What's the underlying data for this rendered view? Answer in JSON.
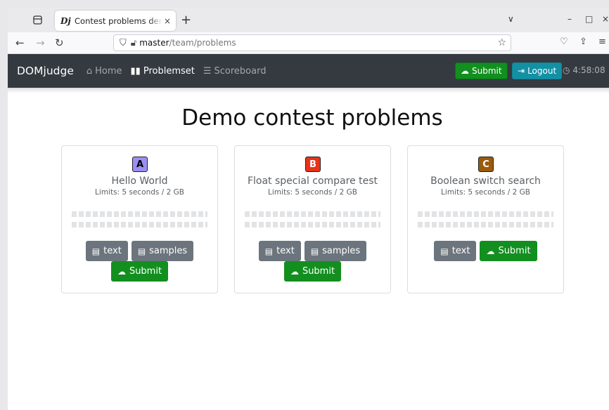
{
  "browser": {
    "tab_title": "Contest problems demo",
    "tab_favicon": "Dj",
    "tab_close": "×",
    "new_tab": "+",
    "url_host": "master",
    "url_path": "/team/problems",
    "window_controls": [
      "∨",
      "–",
      "□",
      "×"
    ]
  },
  "navbar": {
    "brand": "DOMjudge",
    "links": [
      {
        "label": "Home",
        "icon": "home-icon"
      },
      {
        "label": "Problemset",
        "icon": "book-icon"
      },
      {
        "label": "Scoreboard",
        "icon": "list-icon"
      }
    ],
    "submit_label": "Submit",
    "logout_label": "Logout",
    "clock": "4:58:08"
  },
  "page": {
    "title": "Demo contest problems"
  },
  "problems": [
    {
      "letter": "A",
      "name": "Hello World",
      "limits": "Limits: 5 seconds / 2 GB",
      "color": "#9b8ff5",
      "text_color": "#000",
      "buttons": [
        "text",
        "samples"
      ],
      "submit": "Submit"
    },
    {
      "letter": "B",
      "name": "Float special compare test",
      "limits": "Limits: 5 seconds / 2 GB",
      "color": "#e8331a",
      "text_color": "#fff",
      "buttons": [
        "text",
        "samples"
      ],
      "submit": "Submit"
    },
    {
      "letter": "C",
      "name": "Boolean switch search",
      "limits": "Limits: 5 seconds / 2 GB",
      "color": "#9a5b0c",
      "text_color": "#fff",
      "buttons": [
        "text"
      ],
      "submit": "Submit"
    }
  ]
}
